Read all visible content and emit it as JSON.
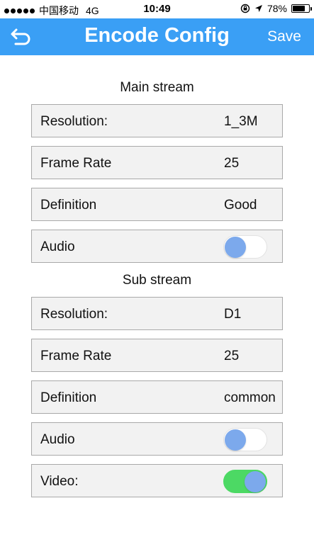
{
  "status_bar": {
    "carrier": "中国移动",
    "network": "4G",
    "time": "10:49",
    "battery": "78%",
    "battery_level": 0.78
  },
  "nav": {
    "title": "Encode Config",
    "save_label": "Save",
    "bar_color": "#3a9ff5"
  },
  "main_stream": {
    "title": "Main stream",
    "resolution": {
      "label": "Resolution:",
      "value": "1_3M"
    },
    "frame_rate": {
      "label": "Frame Rate",
      "value": "25"
    },
    "definition": {
      "label": "Definition",
      "value": "Good"
    },
    "audio": {
      "label": "Audio",
      "on": false
    }
  },
  "sub_stream": {
    "title": "Sub stream",
    "resolution": {
      "label": "Resolution:",
      "value": "D1"
    },
    "frame_rate": {
      "label": "Frame Rate",
      "value": "25"
    },
    "definition": {
      "label": "Definition",
      "value": "common"
    },
    "audio": {
      "label": "Audio",
      "on": false
    },
    "video": {
      "label": "Video:",
      "on": true
    }
  }
}
